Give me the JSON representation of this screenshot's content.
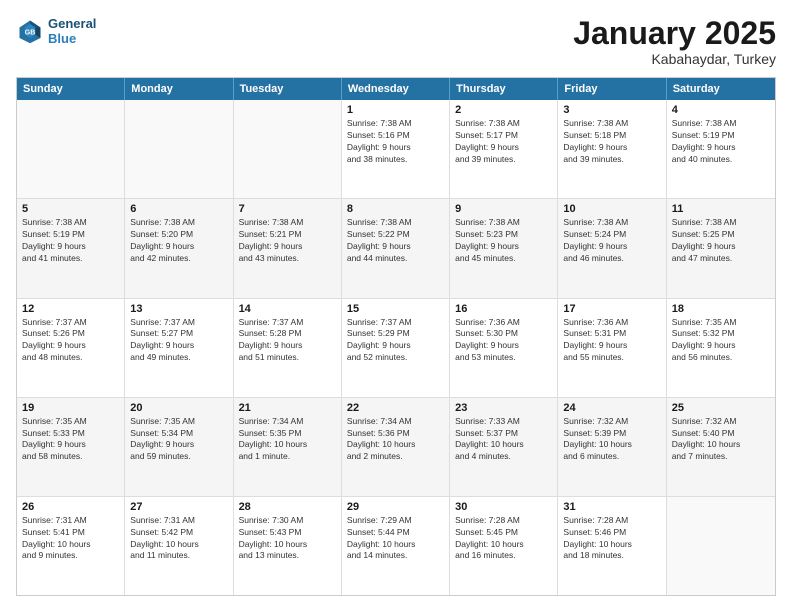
{
  "logo": {
    "line1": "General",
    "line2": "Blue"
  },
  "title": "January 2025",
  "subtitle": "Kabahaydar, Turkey",
  "header": {
    "days": [
      "Sunday",
      "Monday",
      "Tuesday",
      "Wednesday",
      "Thursday",
      "Friday",
      "Saturday"
    ]
  },
  "weeks": [
    {
      "cells": [
        {
          "day": "",
          "info": "",
          "empty": true
        },
        {
          "day": "",
          "info": "",
          "empty": true
        },
        {
          "day": "",
          "info": "",
          "empty": true
        },
        {
          "day": "1",
          "info": "Sunrise: 7:38 AM\nSunset: 5:16 PM\nDaylight: 9 hours\nand 38 minutes."
        },
        {
          "day": "2",
          "info": "Sunrise: 7:38 AM\nSunset: 5:17 PM\nDaylight: 9 hours\nand 39 minutes."
        },
        {
          "day": "3",
          "info": "Sunrise: 7:38 AM\nSunset: 5:18 PM\nDaylight: 9 hours\nand 39 minutes."
        },
        {
          "day": "4",
          "info": "Sunrise: 7:38 AM\nSunset: 5:19 PM\nDaylight: 9 hours\nand 40 minutes."
        }
      ]
    },
    {
      "cells": [
        {
          "day": "5",
          "info": "Sunrise: 7:38 AM\nSunset: 5:19 PM\nDaylight: 9 hours\nand 41 minutes."
        },
        {
          "day": "6",
          "info": "Sunrise: 7:38 AM\nSunset: 5:20 PM\nDaylight: 9 hours\nand 42 minutes."
        },
        {
          "day": "7",
          "info": "Sunrise: 7:38 AM\nSunset: 5:21 PM\nDaylight: 9 hours\nand 43 minutes."
        },
        {
          "day": "8",
          "info": "Sunrise: 7:38 AM\nSunset: 5:22 PM\nDaylight: 9 hours\nand 44 minutes."
        },
        {
          "day": "9",
          "info": "Sunrise: 7:38 AM\nSunset: 5:23 PM\nDaylight: 9 hours\nand 45 minutes."
        },
        {
          "day": "10",
          "info": "Sunrise: 7:38 AM\nSunset: 5:24 PM\nDaylight: 9 hours\nand 46 minutes."
        },
        {
          "day": "11",
          "info": "Sunrise: 7:38 AM\nSunset: 5:25 PM\nDaylight: 9 hours\nand 47 minutes."
        }
      ]
    },
    {
      "cells": [
        {
          "day": "12",
          "info": "Sunrise: 7:37 AM\nSunset: 5:26 PM\nDaylight: 9 hours\nand 48 minutes."
        },
        {
          "day": "13",
          "info": "Sunrise: 7:37 AM\nSunset: 5:27 PM\nDaylight: 9 hours\nand 49 minutes."
        },
        {
          "day": "14",
          "info": "Sunrise: 7:37 AM\nSunset: 5:28 PM\nDaylight: 9 hours\nand 51 minutes."
        },
        {
          "day": "15",
          "info": "Sunrise: 7:37 AM\nSunset: 5:29 PM\nDaylight: 9 hours\nand 52 minutes."
        },
        {
          "day": "16",
          "info": "Sunrise: 7:36 AM\nSunset: 5:30 PM\nDaylight: 9 hours\nand 53 minutes."
        },
        {
          "day": "17",
          "info": "Sunrise: 7:36 AM\nSunset: 5:31 PM\nDaylight: 9 hours\nand 55 minutes."
        },
        {
          "day": "18",
          "info": "Sunrise: 7:35 AM\nSunset: 5:32 PM\nDaylight: 9 hours\nand 56 minutes."
        }
      ]
    },
    {
      "cells": [
        {
          "day": "19",
          "info": "Sunrise: 7:35 AM\nSunset: 5:33 PM\nDaylight: 9 hours\nand 58 minutes."
        },
        {
          "day": "20",
          "info": "Sunrise: 7:35 AM\nSunset: 5:34 PM\nDaylight: 9 hours\nand 59 minutes."
        },
        {
          "day": "21",
          "info": "Sunrise: 7:34 AM\nSunset: 5:35 PM\nDaylight: 10 hours\nand 1 minute."
        },
        {
          "day": "22",
          "info": "Sunrise: 7:34 AM\nSunset: 5:36 PM\nDaylight: 10 hours\nand 2 minutes."
        },
        {
          "day": "23",
          "info": "Sunrise: 7:33 AM\nSunset: 5:37 PM\nDaylight: 10 hours\nand 4 minutes."
        },
        {
          "day": "24",
          "info": "Sunrise: 7:32 AM\nSunset: 5:39 PM\nDaylight: 10 hours\nand 6 minutes."
        },
        {
          "day": "25",
          "info": "Sunrise: 7:32 AM\nSunset: 5:40 PM\nDaylight: 10 hours\nand 7 minutes."
        }
      ]
    },
    {
      "cells": [
        {
          "day": "26",
          "info": "Sunrise: 7:31 AM\nSunset: 5:41 PM\nDaylight: 10 hours\nand 9 minutes."
        },
        {
          "day": "27",
          "info": "Sunrise: 7:31 AM\nSunset: 5:42 PM\nDaylight: 10 hours\nand 11 minutes."
        },
        {
          "day": "28",
          "info": "Sunrise: 7:30 AM\nSunset: 5:43 PM\nDaylight: 10 hours\nand 13 minutes."
        },
        {
          "day": "29",
          "info": "Sunrise: 7:29 AM\nSunset: 5:44 PM\nDaylight: 10 hours\nand 14 minutes."
        },
        {
          "day": "30",
          "info": "Sunrise: 7:28 AM\nSunset: 5:45 PM\nDaylight: 10 hours\nand 16 minutes."
        },
        {
          "day": "31",
          "info": "Sunrise: 7:28 AM\nSunset: 5:46 PM\nDaylight: 10 hours\nand 18 minutes."
        },
        {
          "day": "",
          "info": "",
          "empty": true
        }
      ]
    }
  ]
}
